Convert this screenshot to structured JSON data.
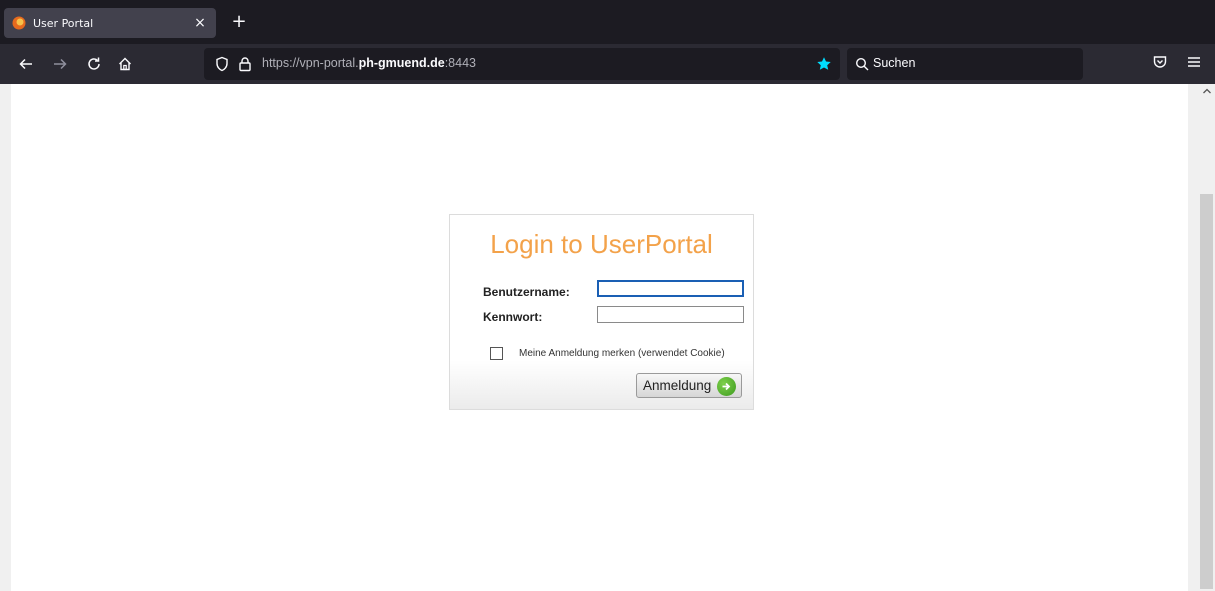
{
  "browser": {
    "tab": {
      "title": "User Portal",
      "close_glyph": "×"
    },
    "new_tab_glyph": "+",
    "url": {
      "prefix": "https://vpn-portal.",
      "domain": "ph-gmuend.de",
      "port": ":8443"
    },
    "search_placeholder": "Suchen",
    "colors": {
      "chrome_dark": "#1c1b22",
      "chrome_mid": "#2b2a33",
      "star": "#54ffbd",
      "bookmark_star": "#00ddff"
    }
  },
  "login": {
    "title": "Login to UserPortal",
    "username_label": "Benutzername:",
    "username_value": "",
    "password_label": "Kennwort:",
    "password_value": "",
    "remember_label": "Meine Anmeldung merken (verwendet Cookie)",
    "remember_checked": false,
    "submit_label": "Anmeldung",
    "colors": {
      "title": "#f3a24a",
      "submit_arrow": "#4caf2a"
    }
  }
}
